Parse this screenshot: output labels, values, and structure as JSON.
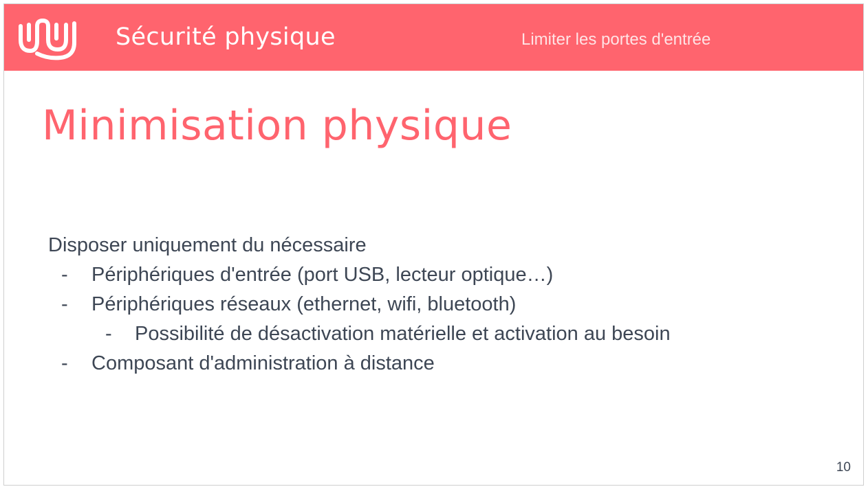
{
  "header": {
    "section_title": "Sécurité physique",
    "section_subtitle": "Limiter les portes d'entrée",
    "logo_icon": "wavy-lines-logo-icon",
    "background_color": "#ff646e"
  },
  "slide": {
    "title": "Minimisation physique",
    "title_color": "#ff646e",
    "intro": "Disposer uniquement du nécessaire",
    "bullets": [
      {
        "dash": "-",
        "text": "Périphériques d'entrée (port USB, lecteur optique…)"
      },
      {
        "dash": "-",
        "text": "Périphériques réseaux (ethernet, wifi, bluetooth)"
      },
      {
        "dash": "-",
        "text": "Possibilité de désactivation matérielle et activation au besoin"
      },
      {
        "dash": "-",
        "text": "Composant d'administration à distance"
      }
    ],
    "page_number": "10"
  }
}
